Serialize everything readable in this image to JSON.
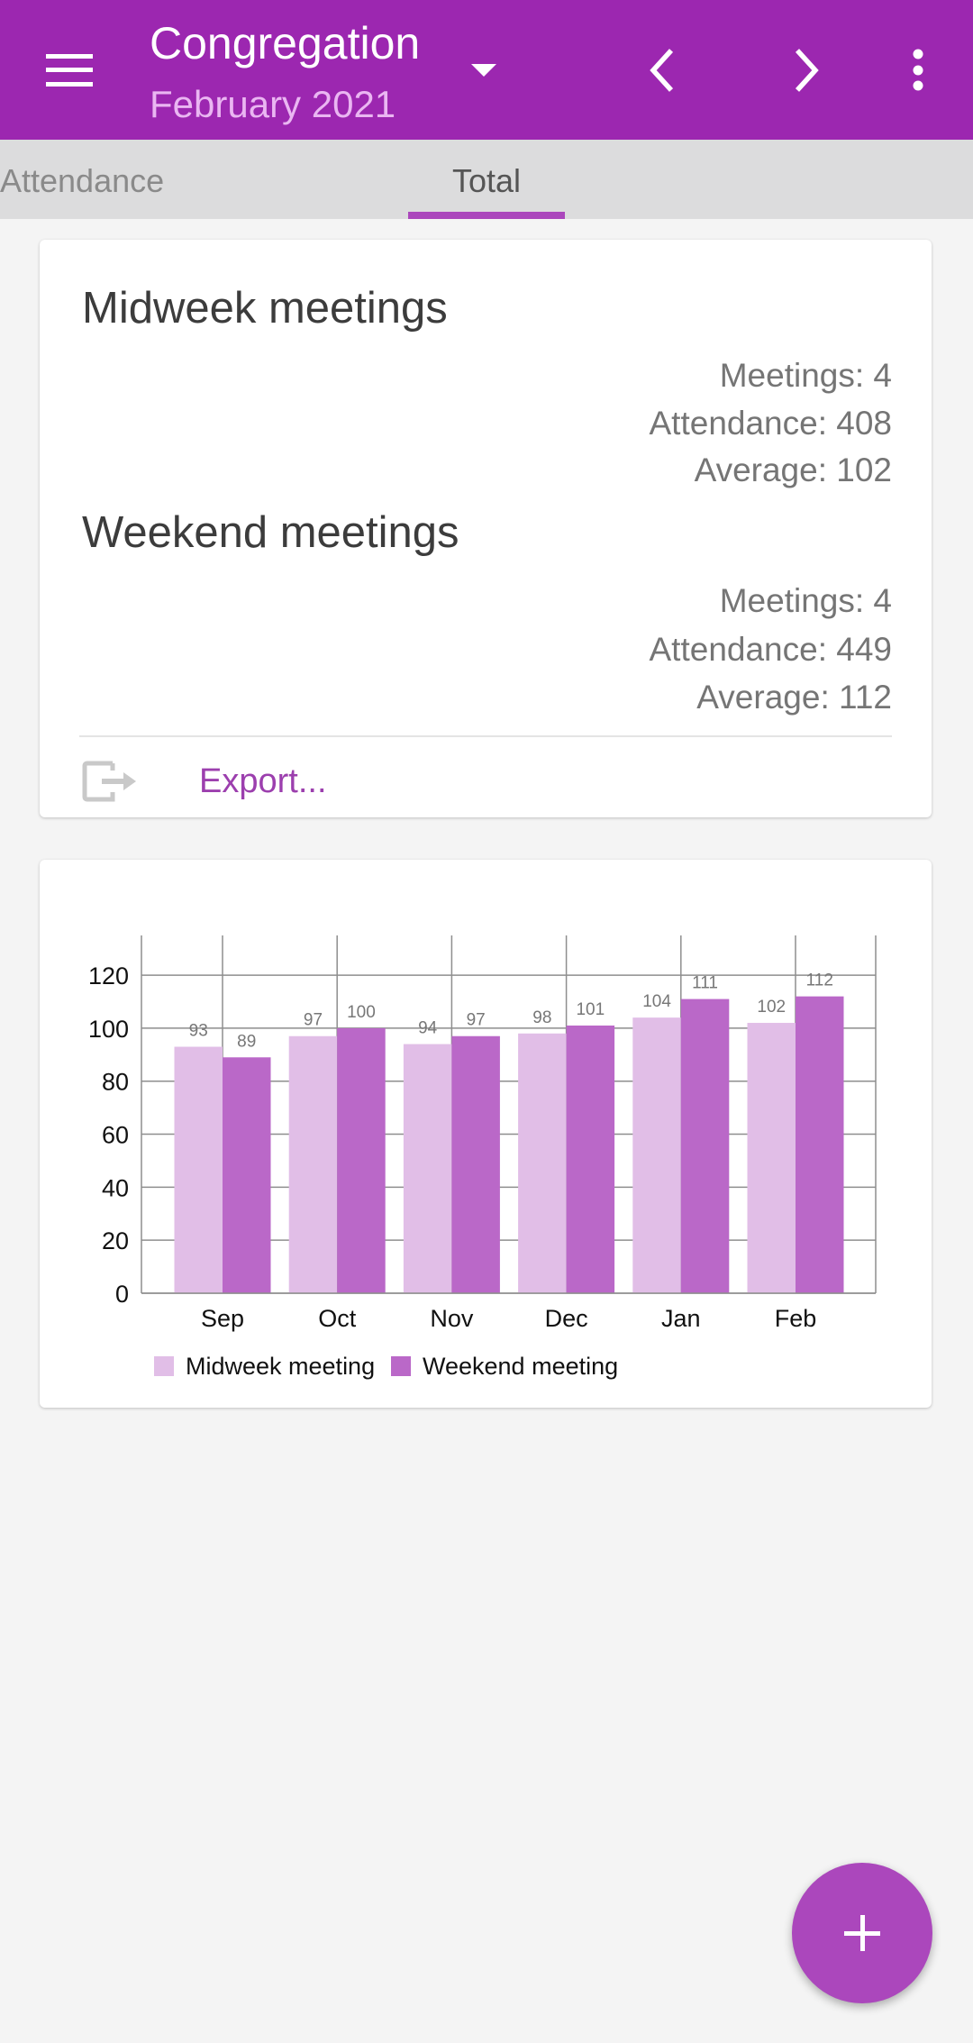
{
  "appbar": {
    "title": "Congregation",
    "subtitle": "February 2021",
    "icons": {
      "menu": "hamburger-menu-icon",
      "dropdown": "dropdown-triangle-icon",
      "previous": "chevron-left-icon",
      "next": "chevron-right-icon",
      "more": "more-vertical-icon"
    },
    "color": "#9c27b0"
  },
  "tabs": [
    {
      "label": "Attendance",
      "selected": false
    },
    {
      "label": "Total",
      "selected": true
    }
  ],
  "summary": {
    "midweek": {
      "title": "Midweek meetings",
      "meetings": "Meetings: 4",
      "attendance": "Attendance: 408",
      "average": "Average: 102"
    },
    "weekend": {
      "title": "Weekend meetings",
      "meetings": "Meetings: 4",
      "attendance": "Attendance: 449",
      "average": "Average: 112"
    },
    "export_label": "Export...",
    "export_icon": "export-icon"
  },
  "fab": {
    "icon": "plus-icon",
    "color": "#ab47bc"
  },
  "chart_data": {
    "type": "bar",
    "title": "",
    "xlabel": "",
    "ylabel": "",
    "categories": [
      "Sep",
      "Oct",
      "Nov",
      "Dec",
      "Jan",
      "Feb"
    ],
    "series": [
      {
        "name": "Midweek meeting",
        "color": "#e1bee7",
        "values": [
          93,
          97,
          94,
          98,
          104,
          102
        ]
      },
      {
        "name": "Weekend meeting",
        "color": "#ba68c8",
        "values": [
          89,
          100,
          97,
          101,
          111,
          112
        ]
      }
    ],
    "yticks": [
      0,
      20,
      40,
      60,
      80,
      100,
      120
    ],
    "ylim": [
      0,
      135
    ],
    "grid": true,
    "data_labels": true,
    "legend_position": "bottom-left"
  }
}
